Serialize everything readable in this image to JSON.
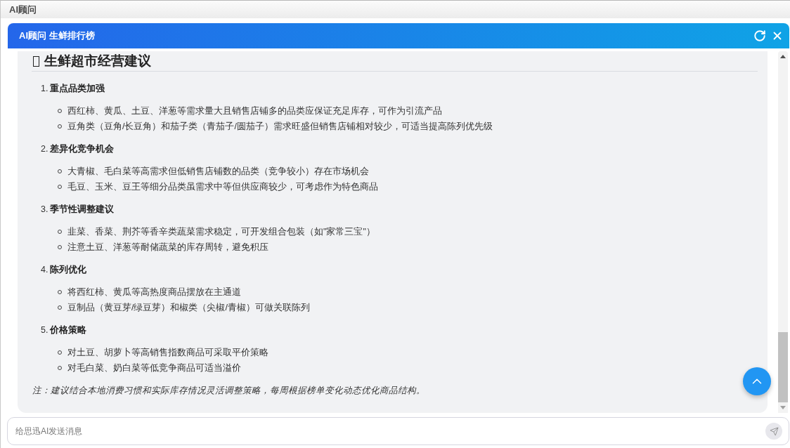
{
  "app_bar": {
    "title": "AI顾问"
  },
  "dialog": {
    "title": "AI顾问 生鲜排行榜"
  },
  "message": {
    "heading": "生鲜超市经营建议",
    "sections": [
      {
        "number": "1.",
        "title": "重点品类加强",
        "points": [
          "西红柿、黄瓜、土豆、洋葱等需求量大且销售店铺多的品类应保证充足库存，可作为引流产品",
          "豆角类（豆角/长豆角）和茄子类（青茄子/圆茄子）需求旺盛但销售店铺相对较少，可适当提高陈列优先级"
        ]
      },
      {
        "number": "2.",
        "title": "差异化竞争机会",
        "points": [
          "大青椒、毛白菜等高需求但低销售店铺数的品类（竞争较小）存在市场机会",
          "毛豆、玉米、豆王等细分品类虽需求中等但供应商较少，可考虑作为特色商品"
        ]
      },
      {
        "number": "3.",
        "title": "季节性调整建议",
        "points": [
          "韭菜、香菜、荆芥等香辛类蔬菜需求稳定，可开发组合包装（如\"家常三宝\"）",
          "注意土豆、洋葱等耐储蔬菜的库存周转，避免积压"
        ]
      },
      {
        "number": "4.",
        "title": "陈列优化",
        "points": [
          "将西红柿、黄瓜等高热度商品摆放在主通道",
          "豆制品（黄豆芽/绿豆芽）和椒类（尖椒/青椒）可做关联陈列"
        ]
      },
      {
        "number": "5.",
        "title": "价格策略",
        "points": [
          "对土豆、胡萝卜等高销售指数商品可采取平价策略",
          "对毛白菜、奶白菜等低竞争商品可适当溢价"
        ]
      }
    ],
    "note": "注：建议结合本地消费习惯和实际库存情况灵活调整策略，每周根据榜单变化动态优化商品结构。"
  },
  "composer": {
    "placeholder": "给思迅AI发送消息"
  }
}
